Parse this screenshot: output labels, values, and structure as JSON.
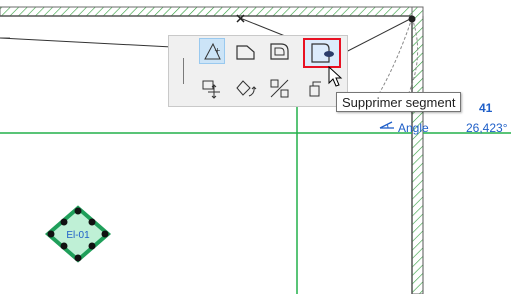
{
  "tooltip": {
    "text": "Supprimer segment"
  },
  "info_panel": {
    "partial_value": "41",
    "angle_label": "Angle",
    "angle_value": "26,423°"
  },
  "element_id": "El-01",
  "pet_palette": {
    "row1": [
      "polygon-select-icon",
      "edge-offset-icon",
      "rounded-corner-icon",
      "delete-segment-icon"
    ],
    "row2": [
      "move-icon",
      "rotate-icon",
      "mirror-icon",
      "copy-icon"
    ],
    "selected": "polygon-select-icon",
    "highlighted": "delete-segment-icon"
  },
  "colors": {
    "accent_green": "#22b04a",
    "highlight_red": "#e81123",
    "info_blue": "#1f5fc8",
    "hatch_green": "#2e9b3a"
  }
}
